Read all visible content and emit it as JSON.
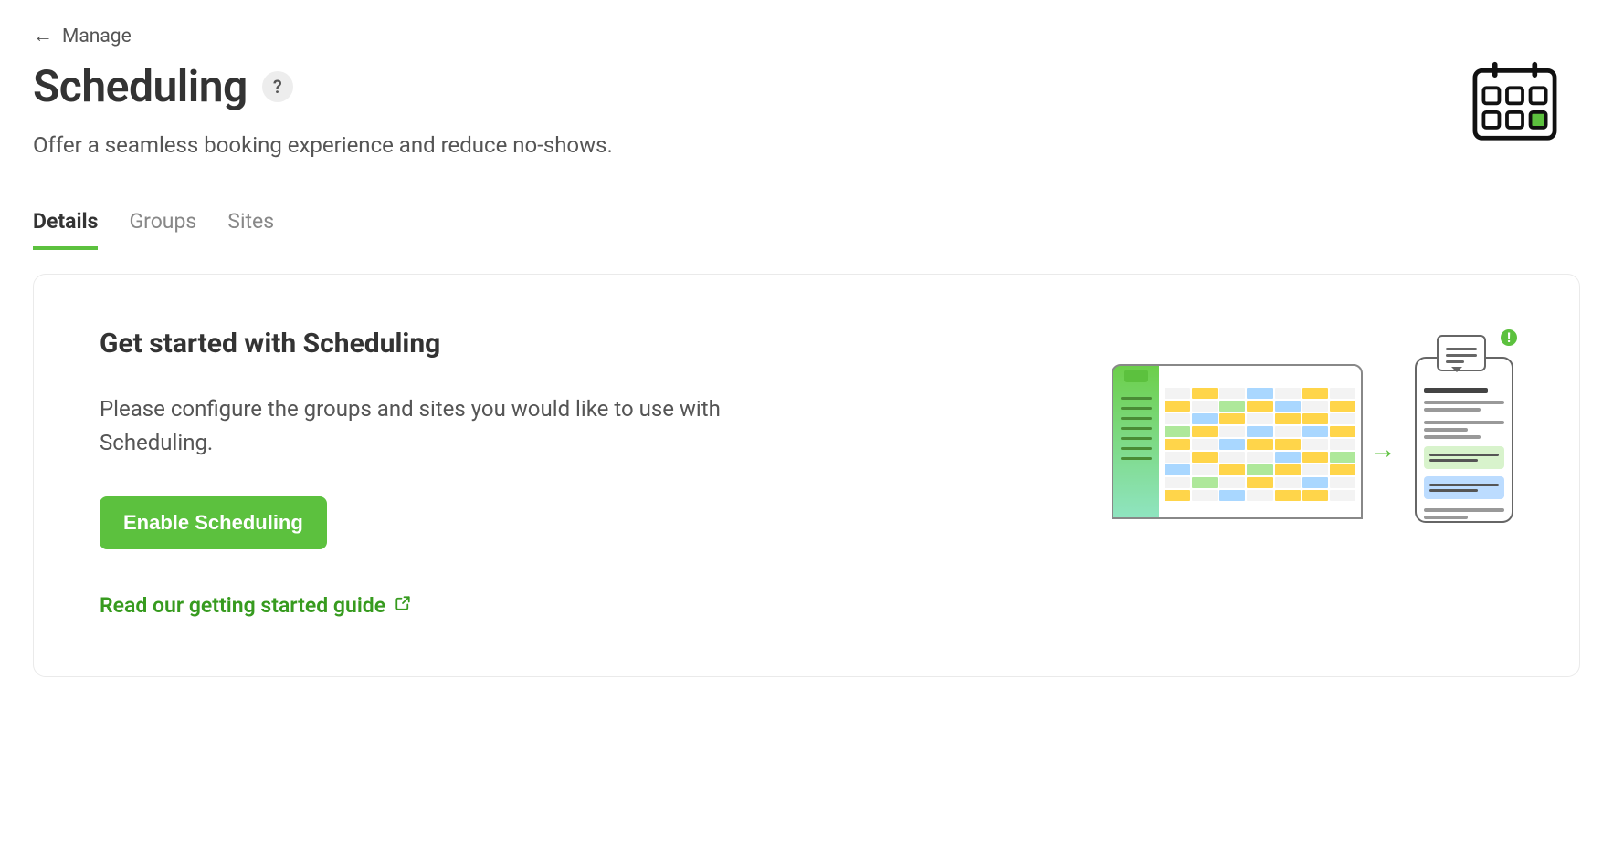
{
  "breadcrumb": {
    "back_label": "Manage"
  },
  "header": {
    "title": "Scheduling",
    "subtitle": "Offer a seamless booking experience and reduce no-shows."
  },
  "tabs": [
    {
      "label": "Details",
      "active": true
    },
    {
      "label": "Groups",
      "active": false
    },
    {
      "label": "Sites",
      "active": false
    }
  ],
  "card": {
    "heading": "Get started with Scheduling",
    "description": "Please configure the groups and sites you would like to use with Scheduling.",
    "primary_button": "Enable Scheduling",
    "guide_link": "Read our getting started guide"
  }
}
